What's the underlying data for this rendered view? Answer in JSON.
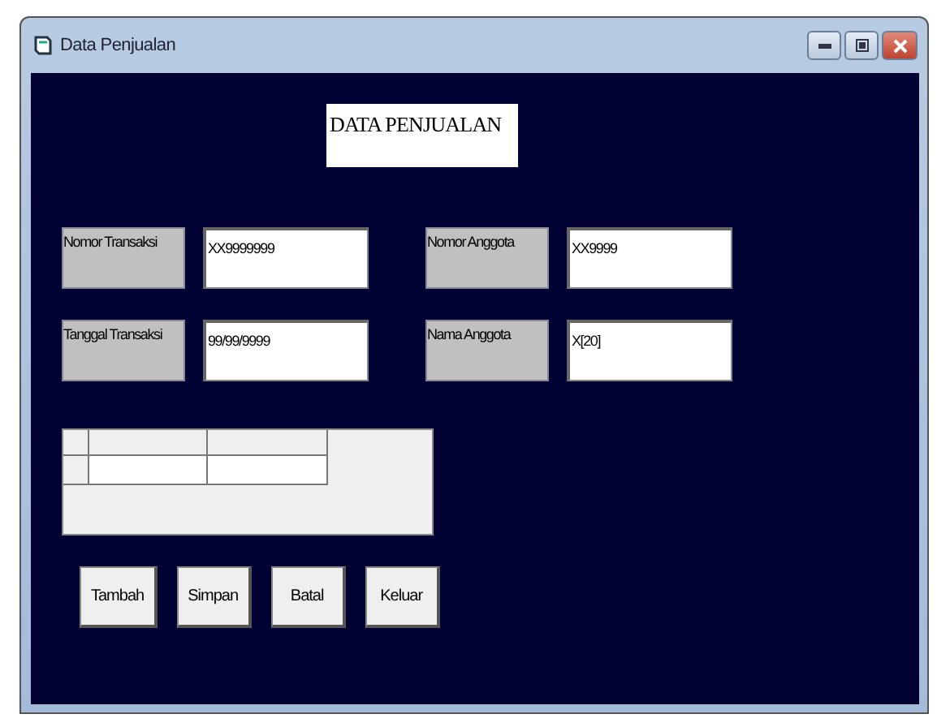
{
  "window": {
    "title": "Data Penjualan"
  },
  "heading": "DATA PENJUALAN",
  "fields": [
    {
      "label": "Nomor Transaksi",
      "value": "XX9999999"
    },
    {
      "label": "Nomor Anggota",
      "value": "XX9999"
    },
    {
      "label": "Tanggal Transaksi",
      "value": "99/99/9999"
    },
    {
      "label": "Nama Anggota",
      "value": "X[20]"
    }
  ],
  "buttons": [
    "Tambah",
    "Simpan",
    "Batal",
    "Keluar"
  ]
}
